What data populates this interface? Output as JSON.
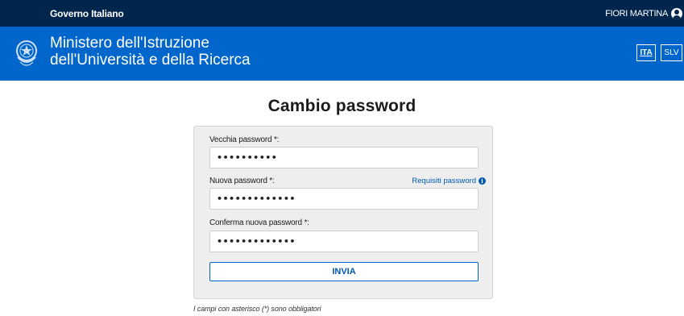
{
  "topbar": {
    "government": "Governo Italiano",
    "user_name": "FIORI MARTINA",
    "user_icon": "user-circle-icon"
  },
  "header": {
    "ministry_line1": "Ministero dell'Istruzione",
    "ministry_line2": "dell'Università e della Ricerca",
    "emblem_icon": "italian-republic-emblem-icon",
    "languages": [
      "ITA",
      "SLV"
    ],
    "selected_language": "ITA"
  },
  "page": {
    "title": "Cambio password"
  },
  "form": {
    "old_password_label": "Vecchia password *:",
    "old_password_value": "••••••••••",
    "new_password_label": "Nuova password *:",
    "new_password_value": "•••••••••••••",
    "requirements_link": "Requisiti password",
    "info_icon_glyph": "i",
    "confirm_password_label": "Conferma nuova password *:",
    "confirm_password_value": "•••••••••••••",
    "submit_label": "INVIA"
  },
  "footer_note": "I campi con asterisco (*) sono obbligatori",
  "colors": {
    "topbar": "#00264d",
    "header": "#0066cc",
    "accent": "#0059b3",
    "card": "#eeeeee"
  }
}
